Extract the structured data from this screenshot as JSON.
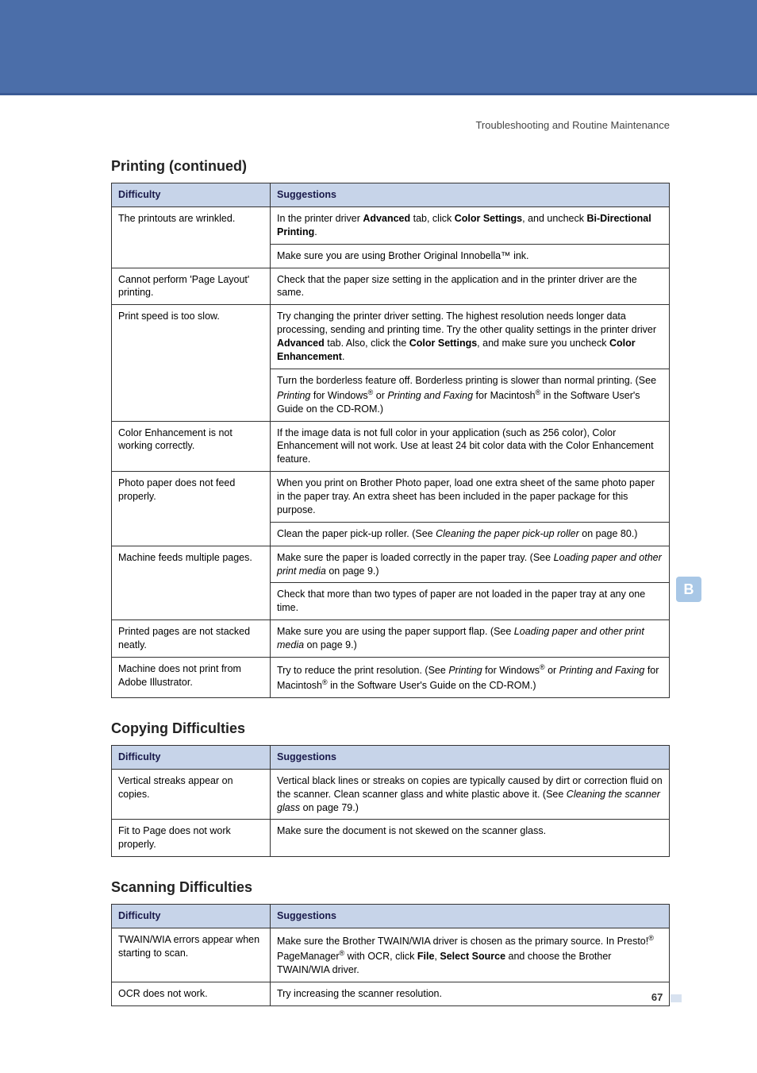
{
  "breadcrumb": "Troubleshooting and Routine Maintenance",
  "sideTab": "B",
  "pageNumber": "67",
  "sections": [
    {
      "title": "Printing (continued)",
      "headers": {
        "d": "Difficulty",
        "s": "Suggestions"
      },
      "rows": [
        {
          "d": "The printouts are wrinkled.",
          "s": [
            {
              "parts": [
                {
                  "t": "In the printer driver "
                },
                {
                  "t": "Advanced",
                  "b": true
                },
                {
                  "t": " tab, click "
                },
                {
                  "t": "Color Settings",
                  "b": true
                },
                {
                  "t": ", and uncheck "
                },
                {
                  "t": "Bi-Directional Printing",
                  "b": true
                },
                {
                  "t": "."
                }
              ]
            },
            {
              "parts": [
                {
                  "t": "Make sure you are using Brother Original Innobella™ ink."
                }
              ]
            }
          ],
          "rowspan": 2
        },
        {
          "d": "Cannot perform 'Page Layout' printing.",
          "s": [
            {
              "parts": [
                {
                  "t": "Check that the paper size setting in the application and in the printer driver are the same."
                }
              ]
            }
          ]
        },
        {
          "d": "Print speed is too slow.",
          "s": [
            {
              "parts": [
                {
                  "t": "Try changing the printer driver setting. The highest resolution needs longer data processing, sending and printing time. Try the other quality settings in the printer driver "
                },
                {
                  "t": "Advanced",
                  "b": true
                },
                {
                  "t": " tab. Also, click the "
                },
                {
                  "t": "Color Settings",
                  "b": true
                },
                {
                  "t": ", and make sure you uncheck "
                },
                {
                  "t": "Color Enhancement",
                  "b": true
                },
                {
                  "t": "."
                }
              ]
            },
            {
              "parts": [
                {
                  "t": "Turn the borderless feature off. Borderless printing is slower than normal printing. (See "
                },
                {
                  "t": "Printing",
                  "i": true
                },
                {
                  "t": " for Windows"
                },
                {
                  "sup": "®"
                },
                {
                  "t": " or "
                },
                {
                  "t": "Printing and Faxing",
                  "i": true
                },
                {
                  "t": " for Macintosh"
                },
                {
                  "sup": "®"
                },
                {
                  "t": " in the Software User's Guide on the CD-ROM.)"
                }
              ]
            }
          ],
          "rowspan": 2
        },
        {
          "d": "Color Enhancement is not working correctly.",
          "s": [
            {
              "parts": [
                {
                  "t": "If the image data is not full color in your application (such as 256 color), Color Enhancement will not work. Use at least 24 bit color data with the Color Enhancement feature."
                }
              ]
            }
          ]
        },
        {
          "d": "Photo paper does not feed properly.",
          "s": [
            {
              "parts": [
                {
                  "t": "When you print on Brother Photo paper, load one extra sheet of the same photo paper in the paper tray. An extra sheet has been included in the paper package for this purpose."
                }
              ]
            },
            {
              "parts": [
                {
                  "t": "Clean the paper pick-up roller. (See "
                },
                {
                  "t": "Cleaning the paper pick-up roller",
                  "i": true
                },
                {
                  "t": " on page 80.)"
                }
              ]
            }
          ],
          "rowspan": 2
        },
        {
          "d": "Machine feeds multiple pages.",
          "s": [
            {
              "parts": [
                {
                  "t": "Make sure the paper is loaded correctly in the paper tray. (See "
                },
                {
                  "t": "Loading paper and other print media",
                  "i": true
                },
                {
                  "t": " on page 9.)"
                }
              ]
            },
            {
              "parts": [
                {
                  "t": "Check that more than two types of paper are not loaded in the paper tray at any one time."
                }
              ]
            }
          ],
          "rowspan": 2
        },
        {
          "d": "Printed pages are not stacked neatly.",
          "s": [
            {
              "parts": [
                {
                  "t": "Make sure you are using the paper support flap. (See "
                },
                {
                  "t": "Loading paper and other print media",
                  "i": true
                },
                {
                  "t": " on page 9.)"
                }
              ]
            }
          ]
        },
        {
          "d": "Machine does not print from Adobe Illustrator.",
          "s": [
            {
              "parts": [
                {
                  "t": "Try to reduce the print resolution. (See "
                },
                {
                  "t": "Printing",
                  "i": true
                },
                {
                  "t": " for Windows"
                },
                {
                  "sup": "®"
                },
                {
                  "t": " or "
                },
                {
                  "t": "Printing and Faxing",
                  "i": true
                },
                {
                  "t": " for Macintosh"
                },
                {
                  "sup": "®"
                },
                {
                  "t": " in the Software User's Guide on the CD-ROM.)"
                }
              ]
            }
          ]
        }
      ]
    },
    {
      "title": "Copying Difficulties",
      "headers": {
        "d": "Difficulty",
        "s": "Suggestions"
      },
      "rows": [
        {
          "d": "Vertical streaks appear on copies.",
          "s": [
            {
              "parts": [
                {
                  "t": "Vertical black lines or streaks on copies are typically caused by dirt or correction fluid on the scanner. Clean scanner glass and white plastic above it. (See "
                },
                {
                  "t": "Cleaning the scanner glass",
                  "i": true
                },
                {
                  "t": " on page 79.)"
                }
              ]
            }
          ]
        },
        {
          "d": "Fit to Page does not work properly.",
          "s": [
            {
              "parts": [
                {
                  "t": "Make sure the document is not skewed on the scanner glass."
                }
              ]
            }
          ]
        }
      ]
    },
    {
      "title": "Scanning Difficulties",
      "headers": {
        "d": "Difficulty",
        "s": "Suggestions"
      },
      "rows": [
        {
          "d": "TWAIN/WIA errors appear when starting to scan.",
          "s": [
            {
              "parts": [
                {
                  "t": "Make sure the Brother TWAIN/WIA driver is chosen as the primary source. In Presto!"
                },
                {
                  "sup": "®"
                },
                {
                  "t": " PageManager"
                },
                {
                  "sup": "®"
                },
                {
                  "t": " with OCR, click "
                },
                {
                  "t": "File",
                  "b": true
                },
                {
                  "t": ", "
                },
                {
                  "t": "Select Source",
                  "b": true
                },
                {
                  "t": " and choose the Brother TWAIN/WIA driver."
                }
              ]
            }
          ]
        },
        {
          "d": "OCR does not work.",
          "s": [
            {
              "parts": [
                {
                  "t": "Try increasing the scanner resolution."
                }
              ]
            }
          ]
        }
      ]
    }
  ],
  "chart_data": {
    "type": "table",
    "tables": [
      {
        "title": "Printing (continued)",
        "columns": [
          "Difficulty",
          "Suggestions"
        ],
        "rows": [
          [
            "The printouts are wrinkled.",
            "In the printer driver Advanced tab, click Color Settings, and uncheck Bi-Directional Printing. / Make sure you are using Brother Original Innobella™ ink."
          ],
          [
            "Cannot perform 'Page Layout' printing.",
            "Check that the paper size setting in the application and in the printer driver are the same."
          ],
          [
            "Print speed is too slow.",
            "Try changing the printer driver setting. The highest resolution needs longer data processing, sending and printing time. Try the other quality settings in the printer driver Advanced tab. Also, click the Color Settings, and make sure you uncheck Color Enhancement. / Turn the borderless feature off. Borderless printing is slower than normal printing. (See Printing for Windows® or Printing and Faxing for Macintosh® in the Software User's Guide on the CD-ROM.)"
          ],
          [
            "Color Enhancement is not working correctly.",
            "If the image data is not full color in your application (such as 256 color), Color Enhancement will not work. Use at least 24 bit color data with the Color Enhancement feature."
          ],
          [
            "Photo paper does not feed properly.",
            "When you print on Brother Photo paper, load one extra sheet of the same photo paper in the paper tray. An extra sheet has been included in the paper package for this purpose. / Clean the paper pick-up roller. (See Cleaning the paper pick-up roller on page 80.)"
          ],
          [
            "Machine feeds multiple pages.",
            "Make sure the paper is loaded correctly in the paper tray. (See Loading paper and other print media on page 9.) / Check that more than two types of paper are not loaded in the paper tray at any one time."
          ],
          [
            "Printed pages are not stacked neatly.",
            "Make sure you are using the paper support flap. (See Loading paper and other print media on page 9.)"
          ],
          [
            "Machine does not print from Adobe Illustrator.",
            "Try to reduce the print resolution. (See Printing for Windows® or Printing and Faxing for Macintosh® in the Software User's Guide on the CD-ROM.)"
          ]
        ]
      },
      {
        "title": "Copying Difficulties",
        "columns": [
          "Difficulty",
          "Suggestions"
        ],
        "rows": [
          [
            "Vertical streaks appear on copies.",
            "Vertical black lines or streaks on copies are typically caused by dirt or correction fluid on the scanner. Clean scanner glass and white plastic above it. (See Cleaning the scanner glass on page 79.)"
          ],
          [
            "Fit to Page does not work properly.",
            "Make sure the document is not skewed on the scanner glass."
          ]
        ]
      },
      {
        "title": "Scanning Difficulties",
        "columns": [
          "Difficulty",
          "Suggestions"
        ],
        "rows": [
          [
            "TWAIN/WIA errors appear when starting to scan.",
            "Make sure the Brother TWAIN/WIA driver is chosen as the primary source. In Presto!® PageManager® with OCR, click File, Select Source and choose the Brother TWAIN/WIA driver."
          ],
          [
            "OCR does not work.",
            "Try increasing the scanner resolution."
          ]
        ]
      }
    ]
  }
}
